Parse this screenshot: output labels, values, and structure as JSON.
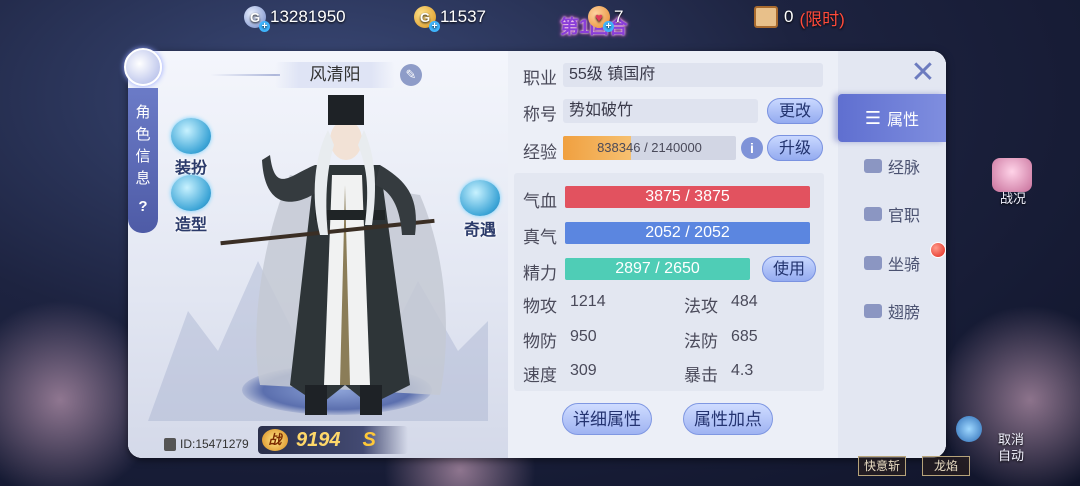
{
  "top_bar": {
    "silver_amount": "13281950",
    "gold_amount": "11537",
    "heart_count": "7",
    "round_text": "第1回合",
    "scroll_count": "0",
    "scroll_limited": "(限时)"
  },
  "role_tab": {
    "label": "角色信息",
    "help": "?"
  },
  "character": {
    "name": "风清阳",
    "id_text": "ID:15471279",
    "power_label": "战",
    "power": "9194",
    "grade": "S"
  },
  "side_buttons": {
    "dress": "装扮",
    "style": "造型",
    "adventure": "奇遇"
  },
  "info": {
    "job_label": "职业",
    "job_value": "55级  镇国府",
    "title_label": "称号",
    "title_value": "势如破竹",
    "change_button": "更改",
    "exp_label": "经验",
    "exp_text": "838346 / 2140000",
    "exp_fraction": 0.3917,
    "upgrade_button": "升级",
    "info_icon": "i"
  },
  "stats": {
    "hp_label": "气血",
    "hp_text": "3875 / 3875",
    "hp_fraction": 1.0,
    "mp_label": "真气",
    "mp_text": "2052 / 2052",
    "mp_fraction": 1.0,
    "sp_label": "精力",
    "sp_text": "2897 / 2650",
    "sp_fraction": 1.0,
    "use_button": "使用",
    "patk_label": "物攻",
    "patk": "1214",
    "matk_label": "法攻",
    "matk": "484",
    "pdef_label": "物防",
    "pdef": "950",
    "mdef_label": "法防",
    "mdef": "685",
    "speed_label": "速度",
    "speed": "309",
    "crit_label": "暴击",
    "crit": "4.3"
  },
  "buttons": {
    "detail": "详细属性",
    "add_points": "属性加点"
  },
  "tabs": [
    {
      "label": "属性",
      "icon": "list-icon",
      "active": true
    },
    {
      "label": "经脉",
      "icon": "meridian-icon",
      "active": false
    },
    {
      "label": "官职",
      "icon": "rank-icon",
      "active": false
    },
    {
      "label": "坐骑",
      "icon": "mount-icon",
      "active": false
    },
    {
      "label": "翅膀",
      "icon": "wings-icon",
      "active": false
    }
  ],
  "outside": {
    "battle_status": "战况",
    "cancel_auto": "取消\n自动",
    "skill_1": "viewing",
    "skill_1_label": "快意斩",
    "skill_2_label": "龙焰"
  },
  "colors": {
    "hp": "#e2525f",
    "mp": "#5b86e0",
    "sp": "#4fcdb6",
    "exp": "#f0a040",
    "accent": "#6474d2"
  }
}
